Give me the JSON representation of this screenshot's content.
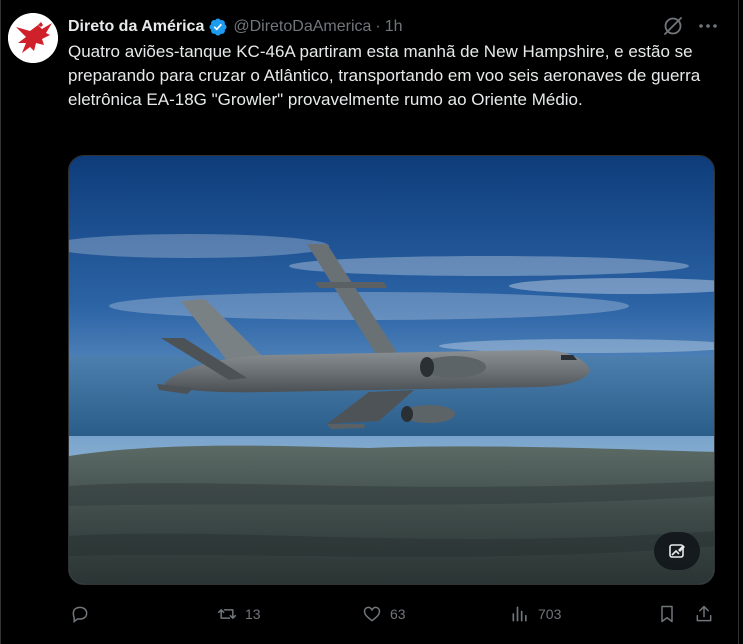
{
  "tweet": {
    "display_name": "Direto da América",
    "handle": "@DiretoDaAmerica",
    "separator": "·",
    "time": "1h",
    "text": "Quatro aviões-tanque KC-46A partiram esta manhã de New Hampshire, e estão se preparando para cruzar o Atlântico, transportando em voo seis aeronaves de guerra eletrônica EA-18G \"Growler\" provavelmente rumo ao Oriente Médio."
  },
  "actions": {
    "reply_count": "",
    "retweet_count": "13",
    "like_count": "63",
    "views_count": "703"
  },
  "icons": {
    "avatar": "red-eagle-logo",
    "verified": "verified-badge-icon",
    "grok": "grok-icon",
    "more": "more-icon",
    "edit_image": "edit-image-icon",
    "reply": "reply-icon",
    "retweet": "retweet-icon",
    "like": "heart-icon",
    "views": "views-icon",
    "bookmark": "bookmark-icon",
    "share": "share-icon"
  },
  "colors": {
    "background": "#000000",
    "text": "#e7e9ea",
    "muted": "#71767b",
    "verified": "#1d9bf0",
    "avatar_logo": "#d0202a"
  }
}
